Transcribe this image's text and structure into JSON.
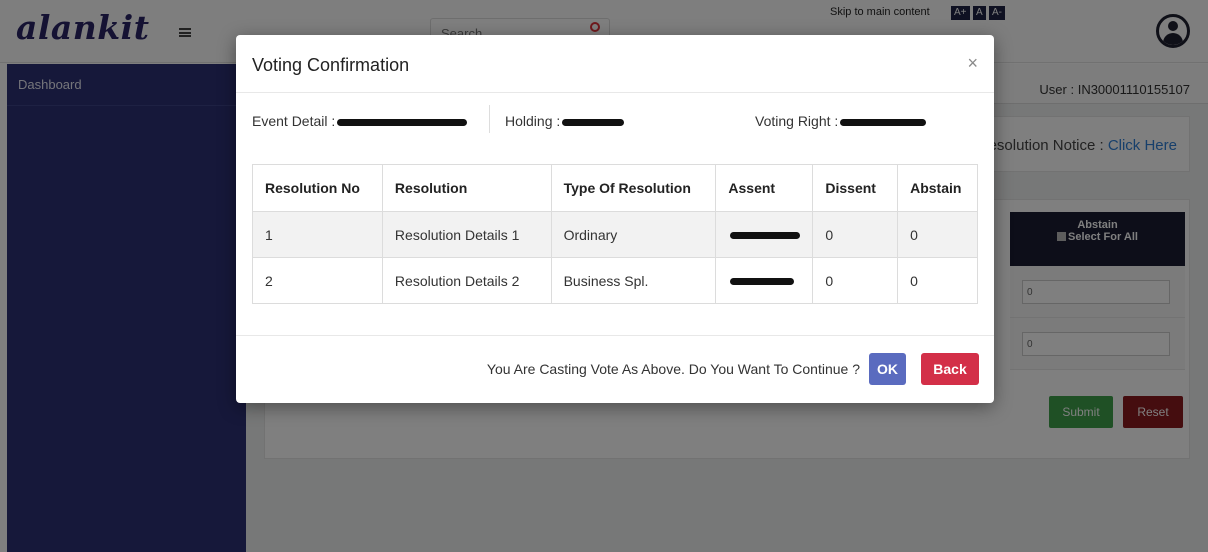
{
  "header": {
    "logo_text": "alankit",
    "search_placeholder": "Search",
    "skip_link": "Skip to main content",
    "font_sizes": [
      "A+",
      "A",
      "A-"
    ]
  },
  "sidebar": {
    "items": [
      {
        "label": "Dashboard"
      }
    ]
  },
  "main": {
    "user_label": "User : IN30001110155107",
    "notice_label": "esolution Notice : ",
    "notice_link": "Click Here",
    "abstain_header": "Abstain",
    "select_for_all": "Select For All",
    "input_values": [
      "0",
      "0"
    ],
    "submit_label": "Submit",
    "reset_label": "Reset"
  },
  "modal": {
    "title": "Voting Confirmation",
    "close_symbol": "×",
    "event_detail_label": "Event Detail :",
    "holding_label": "Holding :",
    "voting_right_label": "Voting Right :",
    "table": {
      "headers": [
        "Resolution No",
        "Resolution",
        "Type Of Resolution",
        "Assent",
        "Dissent",
        "Abstain"
      ],
      "rows": [
        {
          "no": "1",
          "resolution": "Resolution Details 1",
          "type": "Ordinary",
          "dissent": "0",
          "abstain": "0"
        },
        {
          "no": "2",
          "resolution": "Resolution Details 2",
          "type": "Business Spl.",
          "dissent": "0",
          "abstain": "0"
        }
      ]
    },
    "confirm_text": "You Are Casting Vote As Above. Do You Want To Continue ?",
    "ok_label": "OK",
    "back_label": "Back"
  },
  "colors": {
    "sidebar_bg": "#2d3174",
    "ok_button": "#5a6bbf",
    "back_button": "#d32f48",
    "submit_button": "#3ea04b",
    "reset_button": "#8a1a1f"
  },
  "icons": [
    "menu-icon",
    "search-icon",
    "user-avatar-icon",
    "close-icon"
  ]
}
